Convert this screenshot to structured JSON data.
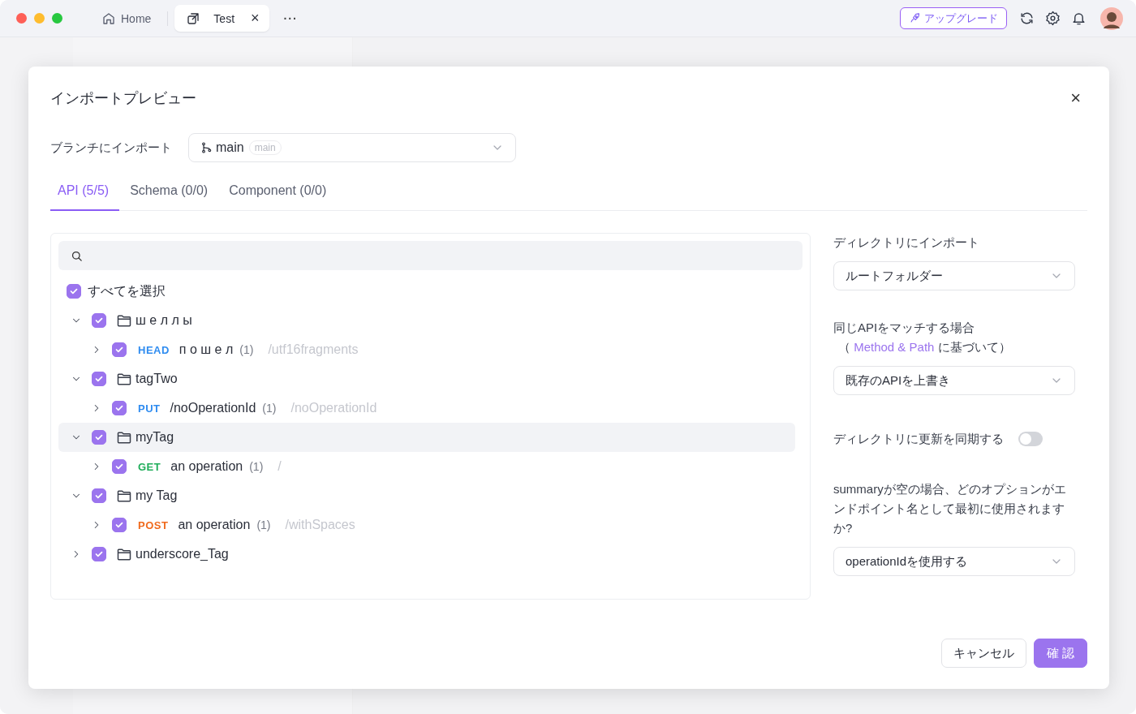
{
  "titlebar": {
    "tabs": [
      {
        "label": "Home",
        "kind": "home",
        "selected": false
      },
      {
        "label": "Test",
        "kind": "doc",
        "selected": true,
        "close": "×"
      }
    ],
    "more": "···",
    "upgrade": "アップグレード"
  },
  "dialog": {
    "title": "インポートプレビュー",
    "close": "×",
    "branch": {
      "label": "ブランチにインポート",
      "value": "main",
      "tag": "main"
    },
    "tabs": [
      {
        "label": "API (5/5)",
        "selected": true
      },
      {
        "label": "Schema (0/0)",
        "selected": false
      },
      {
        "label": "Component (0/0)",
        "selected": false
      }
    ],
    "select_all": {
      "label": "すべてを選択",
      "checked": true
    },
    "tree": [
      {
        "kind": "folder",
        "label": "ш е л л ы",
        "checked": true,
        "expanded": true,
        "selected": false,
        "children": [
          {
            "kind": "endpoint",
            "method": "HEAD",
            "color": "#2f8cf0",
            "label": "п о ш е л",
            "count": "(1)",
            "path": "/utf16fragments",
            "checked": true,
            "expanded": false
          }
        ]
      },
      {
        "kind": "folder",
        "label": "tagTwo",
        "checked": true,
        "expanded": true,
        "selected": false,
        "children": [
          {
            "kind": "endpoint",
            "method": "PUT",
            "color": "#2f8cf0",
            "label": "/noOperationId",
            "count": "(1)",
            "path": "/noOperationId",
            "checked": true,
            "expanded": false
          }
        ]
      },
      {
        "kind": "folder",
        "label": "myTag",
        "checked": true,
        "expanded": true,
        "selected": true,
        "children": [
          {
            "kind": "endpoint",
            "method": "GET",
            "color": "#1fad5a",
            "label": "an operation",
            "count": "(1)",
            "path": "/",
            "checked": true,
            "expanded": false
          }
        ]
      },
      {
        "kind": "folder",
        "label": "my Tag",
        "checked": true,
        "expanded": true,
        "selected": false,
        "children": [
          {
            "kind": "endpoint",
            "method": "POST",
            "color": "#f06a1d",
            "label": "an operation",
            "count": "(1)",
            "path": "/withSpaces",
            "checked": true,
            "expanded": false
          }
        ]
      },
      {
        "kind": "folder",
        "label": "underscore_Tag",
        "checked": true,
        "expanded": false,
        "selected": false
      }
    ],
    "settings": [
      {
        "kind": "select",
        "label": "ディレクトリにインポート",
        "value": "ルートフォルダー"
      },
      {
        "kind": "select",
        "label": "同じAPIをマッチする場合",
        "note": "（ *Method & Path* に基づいて）",
        "value": "既存のAPIを上書き"
      },
      {
        "kind": "switch",
        "label": "ディレクトリに更新を同期する",
        "on": false
      },
      {
        "kind": "select",
        "label": "summaryが空の場合、どのオプションがエンドポイント名として最初に使用されますか?",
        "value": "operationIdを使用する"
      }
    ],
    "buttons": [
      {
        "label": "キャンセル",
        "kind": "secondary"
      },
      {
        "label": "確 認",
        "kind": "primary"
      }
    ]
  }
}
